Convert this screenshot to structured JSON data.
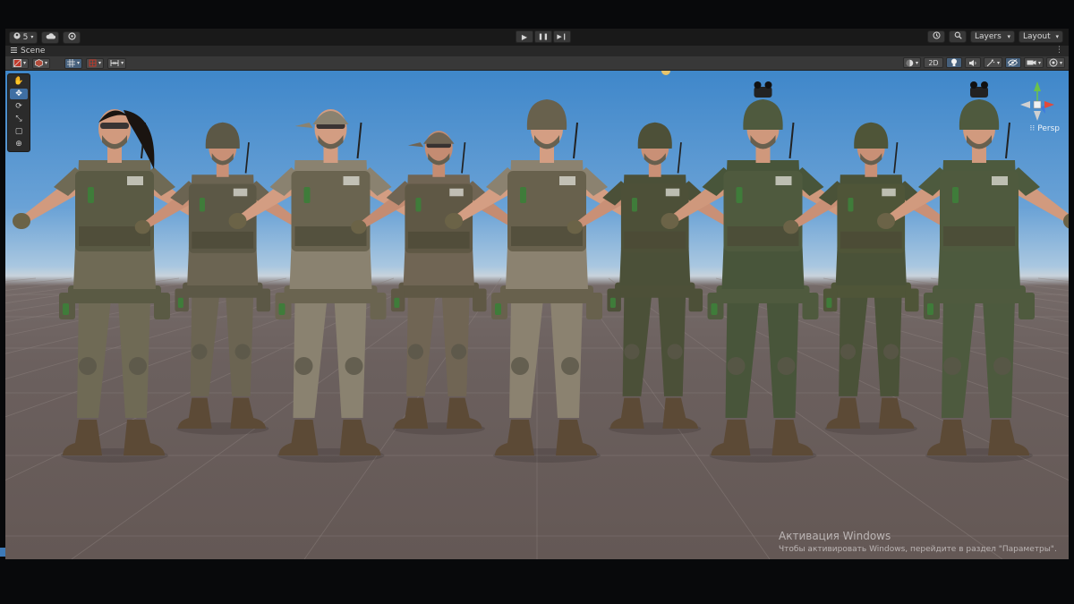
{
  "toolbar": {
    "account_count": "5",
    "account_icon": "account-icon",
    "cloud_icon": "cloud-icon",
    "services_icon": "services-icon",
    "play": {
      "icon": "play-icon",
      "glyph": "▶"
    },
    "pause": {
      "icon": "pause-icon",
      "glyph": "❚❚"
    },
    "step": {
      "icon": "step-icon",
      "glyph": "▶❙"
    },
    "history_icon": "history-icon",
    "search_icon": "search-icon",
    "layers_label": "Layers",
    "layout_label": "Layout"
  },
  "tab": {
    "label": "Scene",
    "icon": "menu-icon"
  },
  "scene_toolbar": {
    "left": [
      {
        "name": "draw-mode-dropdown",
        "icon": "shaded-icon"
      },
      {
        "name": "render-debug-dropdown",
        "icon": "cube-icon"
      },
      {
        "name": "pivot-dropdown",
        "icon": "grid-icon"
      },
      {
        "name": "snap-dropdown",
        "icon": "snap-icon"
      },
      {
        "name": "increment-dropdown",
        "icon": "increment-icon"
      }
    ],
    "mode_2d_label": "2D",
    "right": [
      {
        "name": "draw-modes-button",
        "icon": "sphere-icon"
      },
      {
        "name": "lighting-toggle",
        "icon": "light-bulb-icon"
      },
      {
        "name": "audio-toggle",
        "icon": "audio-icon"
      },
      {
        "name": "effects-dropdown",
        "icon": "effects-icon"
      },
      {
        "name": "visibility-toggle",
        "icon": "eye-off-icon"
      },
      {
        "name": "camera-dropdown",
        "icon": "camera-icon"
      },
      {
        "name": "gizmos-dropdown",
        "icon": "gizmo-icon"
      }
    ]
  },
  "tools": [
    {
      "name": "view-tool",
      "icon": "hand-icon",
      "glyph": "✋",
      "active": false
    },
    {
      "name": "move-tool",
      "icon": "move-icon",
      "glyph": "✥",
      "active": true
    },
    {
      "name": "rotate-tool",
      "icon": "rotate-icon",
      "glyph": "⟳",
      "active": false
    },
    {
      "name": "scale-tool",
      "icon": "scale-icon",
      "glyph": "⤡",
      "active": false
    },
    {
      "name": "rect-tool",
      "icon": "rect-icon",
      "glyph": "▢",
      "active": false
    },
    {
      "name": "transform-tool",
      "icon": "transform-icon",
      "glyph": "⊕",
      "active": false
    }
  ],
  "scene": {
    "persp_label": "Persp",
    "persp_icon": "lock-grid-icon",
    "soldiers": [
      {
        "camo": "#6f6a55",
        "vest": "#5a5a44",
        "skin": "#d19a7e",
        "hair": "#1a1410",
        "head": "ponytail",
        "scale": 1.0
      },
      {
        "camo": "#6b6452",
        "vest": "#5c5846",
        "skin": "#c99076",
        "hair": "#2a2018",
        "head": "helmet",
        "scale": 0.86
      },
      {
        "camo": "#8a8270",
        "vest": "#6a6450",
        "skin": "#d39d82",
        "hair": "#2a2018",
        "head": "cap",
        "scale": 1.0
      },
      {
        "camo": "#706554",
        "vest": "#5f5845",
        "skin": "#c48c72",
        "hair": "#3a2c20",
        "head": "cap",
        "scale": 0.86
      },
      {
        "camo": "#8b8270",
        "vest": "#68614d",
        "skin": "#d49e83",
        "hair": "#3a2c20",
        "head": "helmet",
        "scale": 1.0
      },
      {
        "camo": "#4b5038",
        "vest": "#4d5038",
        "skin": "#c99076",
        "hair": "#2a2018",
        "head": "helmet",
        "scale": 0.86
      },
      {
        "camo": "#48553a",
        "vest": "#4f5a3e",
        "skin": "#cf987c",
        "hair": "#2a2018",
        "head": "nvg",
        "scale": 1.0
      },
      {
        "camo": "#4a5238",
        "vest": "#4f5538",
        "skin": "#c99076",
        "hair": "#2a2018",
        "head": "helmet",
        "scale": 0.86
      },
      {
        "camo": "#4d5a3e",
        "vest": "#4f5a3e",
        "skin": "#d19a7e",
        "hair": "#2a2018",
        "head": "nvg",
        "scale": 1.0
      }
    ]
  },
  "watermark": {
    "title": "Активация Windows",
    "subtitle": "Чтобы активировать Windows, перейдите в раздел \"Параметры\"."
  },
  "colors": {
    "editor_bg": "#191919",
    "toolbar_bg": "#383838",
    "accent": "#3f6fa3",
    "sky_top": "#3f87ca",
    "ground": "#6b605e"
  }
}
